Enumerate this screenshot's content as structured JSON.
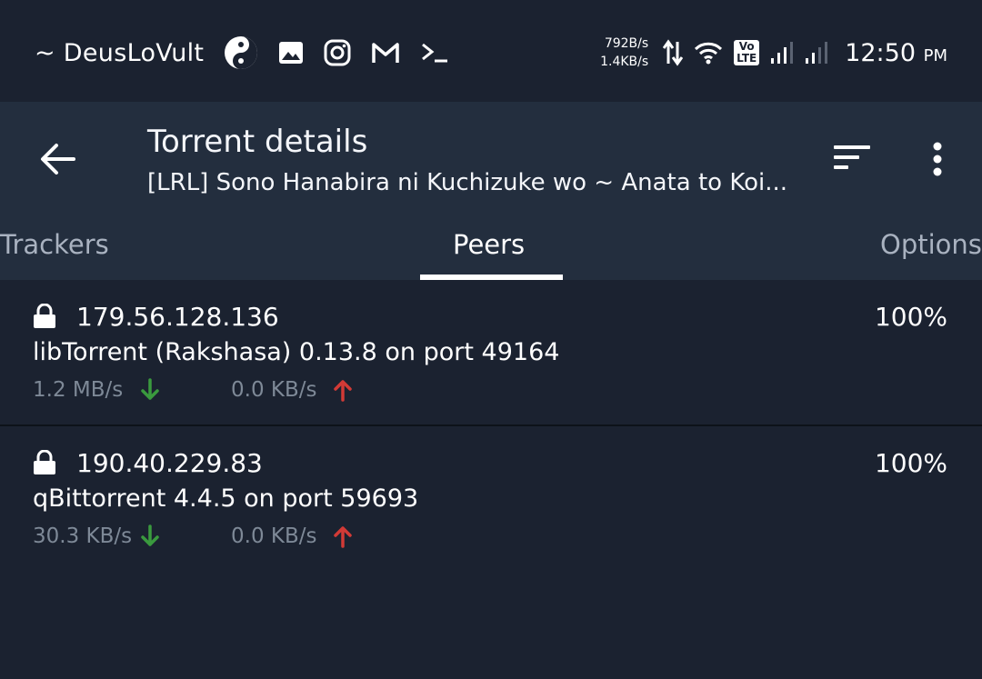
{
  "status_bar": {
    "username": "~ DeusLoVult",
    "net_up": "792B/s",
    "net_down": "1.4KB/s",
    "volte_top": "Vo",
    "volte_bottom": "LTE",
    "time": "12:50",
    "ampm": "PM"
  },
  "toolbar": {
    "title": "Torrent details",
    "subtitle": "[LRL] Sono Hanabira ni Kuchizuke wo ~ Anata to Koi..."
  },
  "tabs": [
    {
      "label": "Trackers",
      "active": false
    },
    {
      "label": "Peers",
      "active": true
    },
    {
      "label": "Options",
      "active": false
    }
  ],
  "peers": [
    {
      "ip": "179.56.128.136",
      "progress": "100%",
      "client": "libTorrent (Rakshasa) 0.13.8 on port 49164",
      "download_speed": "1.2 MB/s",
      "upload_speed": "0.0 KB/s"
    },
    {
      "ip": "190.40.229.83",
      "progress": "100%",
      "client": "qBittorrent 4.4.5 on port 59693",
      "download_speed": "30.3 KB/s",
      "upload_speed": "0.0 KB/s"
    }
  ],
  "colors": {
    "background": "#1b2230",
    "toolbar": "#232e3e",
    "download_arrow": "#3a9a3e",
    "upload_arrow": "#d23a36",
    "muted_text": "#7e8997"
  }
}
